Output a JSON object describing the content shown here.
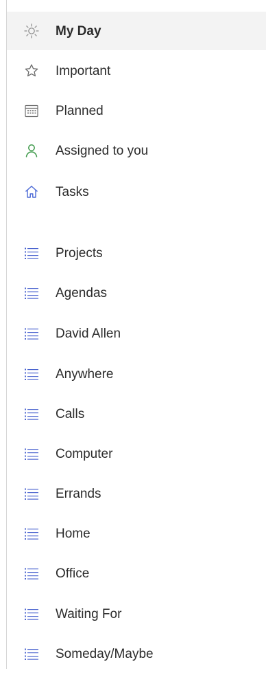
{
  "colors": {
    "text": "#2b2b2b",
    "active_background": "#f3f3f3",
    "divider": "#d6d6d6",
    "my_day_icon": "#8a8a8a",
    "important_icon": "#6b6b6b",
    "planned_icon": "#6f6f6f",
    "assigned_icon": "#3f9a4b",
    "tasks_icon": "#4a68d6",
    "list_icon": "#4b64cf"
  },
  "smart_lists": [
    {
      "label": "My Day",
      "icon": "sun-icon",
      "active": true
    },
    {
      "label": "Important",
      "icon": "star-icon",
      "active": false
    },
    {
      "label": "Planned",
      "icon": "calendar-icon",
      "active": false
    },
    {
      "label": "Assigned to you",
      "icon": "person-icon",
      "active": false
    },
    {
      "label": "Tasks",
      "icon": "home-icon",
      "active": false
    }
  ],
  "lists": [
    {
      "label": "Projects",
      "icon": "list-icon"
    },
    {
      "label": "Agendas",
      "icon": "list-icon"
    },
    {
      "label": "David Allen",
      "icon": "list-icon"
    },
    {
      "label": "Anywhere",
      "icon": "list-icon"
    },
    {
      "label": "Calls",
      "icon": "list-icon"
    },
    {
      "label": "Computer",
      "icon": "list-icon"
    },
    {
      "label": "Errands",
      "icon": "list-icon"
    },
    {
      "label": "Home",
      "icon": "list-icon"
    },
    {
      "label": "Office",
      "icon": "list-icon"
    },
    {
      "label": "Waiting For",
      "icon": "list-icon"
    },
    {
      "label": "Someday/Maybe",
      "icon": "list-icon"
    }
  ]
}
